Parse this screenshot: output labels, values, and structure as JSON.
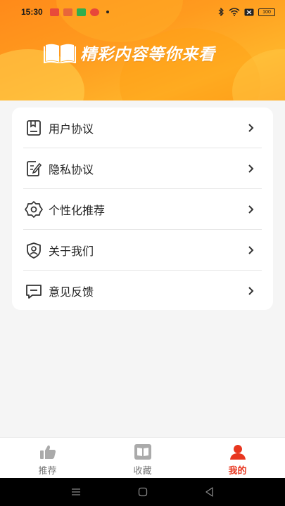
{
  "status_bar": {
    "time": "15:30",
    "battery": "100"
  },
  "banner": {
    "slogan": "精彩内容等你来看"
  },
  "menu": [
    {
      "label": "用户协议",
      "icon": "document-icon"
    },
    {
      "label": "隐私协议",
      "icon": "edit-document-icon"
    },
    {
      "label": "个性化推荐",
      "icon": "gear-icon"
    },
    {
      "label": "关于我们",
      "icon": "shield-user-icon"
    },
    {
      "label": "意见反馈",
      "icon": "message-icon"
    }
  ],
  "tabs": [
    {
      "label": "推荐",
      "icon": "thumbs-up-icon",
      "active": false
    },
    {
      "label": "收藏",
      "icon": "book-icon",
      "active": false
    },
    {
      "label": "我的",
      "icon": "user-icon",
      "active": true
    }
  ],
  "colors": {
    "accent": "#e8361f",
    "banner": "#ff9b1e"
  }
}
